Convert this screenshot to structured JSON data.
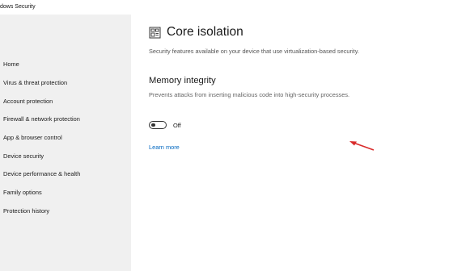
{
  "window": {
    "title": "dows Security"
  },
  "sidebar": {
    "items": [
      {
        "label": "Home"
      },
      {
        "label": "Virus & threat protection"
      },
      {
        "label": "Account protection"
      },
      {
        "label": "Firewall & network protection"
      },
      {
        "label": "App & browser control"
      },
      {
        "label": "Device security"
      },
      {
        "label": "Device performance & health"
      },
      {
        "label": "Family options"
      },
      {
        "label": "Protection history"
      }
    ]
  },
  "main": {
    "title": "Core isolation",
    "title_icon": "core-isolation-icon",
    "description": "Security features available on your device that use virtualization-based security.",
    "memory_integrity": {
      "title": "Memory integrity",
      "description": "Prevents attacks from inserting malicious code into high-security processes.",
      "toggle_state": "Off",
      "toggle_on": false
    },
    "learn_more": "Learn more"
  },
  "annotation": {
    "arrow_color": "#d92b2b",
    "icon": "red-arrow-icon"
  },
  "colors": {
    "sidebar_bg": "#f0f0f0",
    "link": "#0067c0",
    "text": "#1a1a1a",
    "muted_text": "#555555"
  }
}
